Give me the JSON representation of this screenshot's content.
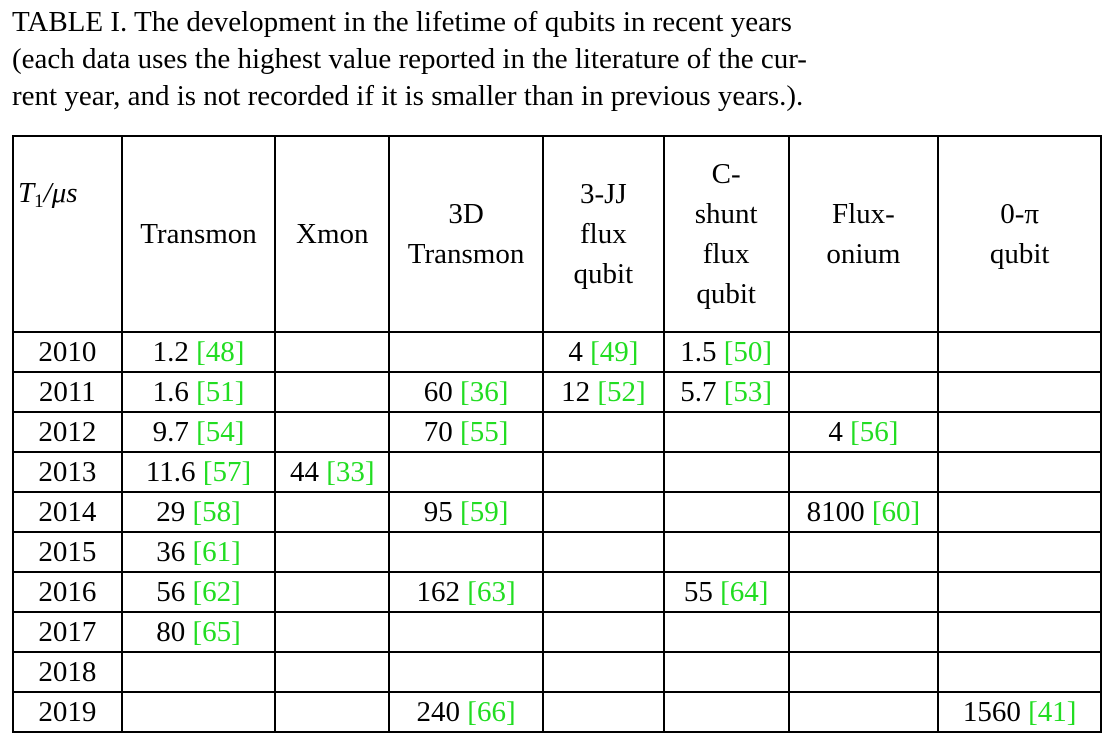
{
  "caption": {
    "line1": "TABLE I. The development in the lifetime of qubits in recent years",
    "line2": "(each data uses the highest value reported in the literature of the cur-",
    "line3": "rent year, and is not recorded if it is smaller than in previous years.)."
  },
  "table": {
    "header": {
      "year_label_main": "T",
      "year_label_sub": "1",
      "year_label_unit": "/μs",
      "columns": [
        {
          "lines": [
            "Transmon"
          ]
        },
        {
          "lines": [
            "Xmon"
          ]
        },
        {
          "lines": [
            "3D",
            "Transmon"
          ]
        },
        {
          "lines": [
            "3-JJ",
            "flux",
            "qubit"
          ]
        },
        {
          "lines": [
            "C-",
            "shunt",
            "flux",
            "qubit"
          ]
        },
        {
          "lines": [
            "Flux-",
            "onium"
          ]
        },
        {
          "lines": [
            "0-π",
            "qubit"
          ]
        }
      ]
    },
    "rows": [
      {
        "year": "2010",
        "cells": [
          [
            "1.2 ",
            "[48]"
          ],
          [
            "",
            ""
          ],
          [
            "",
            ""
          ],
          [
            "4 ",
            "[49]"
          ],
          [
            "1.5 ",
            "[50]"
          ],
          [
            "",
            ""
          ],
          [
            "",
            ""
          ]
        ]
      },
      {
        "year": "2011",
        "cells": [
          [
            "1.6 ",
            "[51]"
          ],
          [
            "",
            ""
          ],
          [
            "60 ",
            "[36]"
          ],
          [
            "12 ",
            "[52]"
          ],
          [
            "5.7 ",
            "[53]"
          ],
          [
            "",
            ""
          ],
          [
            "",
            ""
          ]
        ]
      },
      {
        "year": "2012",
        "cells": [
          [
            "9.7 ",
            "[54]"
          ],
          [
            "",
            ""
          ],
          [
            "70 ",
            "[55]"
          ],
          [
            "",
            ""
          ],
          [
            "",
            ""
          ],
          [
            "4 ",
            "[56]"
          ],
          [
            "",
            ""
          ]
        ]
      },
      {
        "year": "2013",
        "cells": [
          [
            "11.6 ",
            "[57]"
          ],
          [
            "44 ",
            "[33]"
          ],
          [
            "",
            ""
          ],
          [
            "",
            ""
          ],
          [
            "",
            ""
          ],
          [
            "",
            ""
          ],
          [
            "",
            ""
          ]
        ]
      },
      {
        "year": "2014",
        "cells": [
          [
            "29 ",
            "[58]"
          ],
          [
            "",
            ""
          ],
          [
            "95 ",
            "[59]"
          ],
          [
            "",
            ""
          ],
          [
            "",
            ""
          ],
          [
            "8100 ",
            "[60]"
          ],
          [
            "",
            ""
          ]
        ]
      },
      {
        "year": "2015",
        "cells": [
          [
            "36 ",
            "[61]"
          ],
          [
            "",
            ""
          ],
          [
            "",
            ""
          ],
          [
            "",
            ""
          ],
          [
            "",
            ""
          ],
          [
            "",
            ""
          ],
          [
            "",
            ""
          ]
        ]
      },
      {
        "year": "2016",
        "cells": [
          [
            "56 ",
            "[62]"
          ],
          [
            "",
            ""
          ],
          [
            "162 ",
            "[63]"
          ],
          [
            "",
            ""
          ],
          [
            "55 ",
            "[64]"
          ],
          [
            "",
            ""
          ],
          [
            "",
            ""
          ]
        ]
      },
      {
        "year": "2017",
        "cells": [
          [
            "80 ",
            "[65]"
          ],
          [
            "",
            ""
          ],
          [
            "",
            ""
          ],
          [
            "",
            ""
          ],
          [
            "",
            ""
          ],
          [
            "",
            ""
          ],
          [
            "",
            ""
          ]
        ]
      },
      {
        "year": "2018",
        "cells": [
          [
            "",
            ""
          ],
          [
            "",
            ""
          ],
          [
            "",
            ""
          ],
          [
            "",
            ""
          ],
          [
            "",
            ""
          ],
          [
            "",
            ""
          ],
          [
            "",
            ""
          ]
        ]
      },
      {
        "year": "2019",
        "cells": [
          [
            "",
            ""
          ],
          [
            "",
            ""
          ],
          [
            "240 ",
            "[66]"
          ],
          [
            "",
            ""
          ],
          [
            "",
            ""
          ],
          [
            "",
            ""
          ],
          [
            "1560 ",
            "[41]"
          ]
        ]
      }
    ]
  },
  "colors": {
    "reference_link": "#22dd22",
    "text": "#000000"
  }
}
